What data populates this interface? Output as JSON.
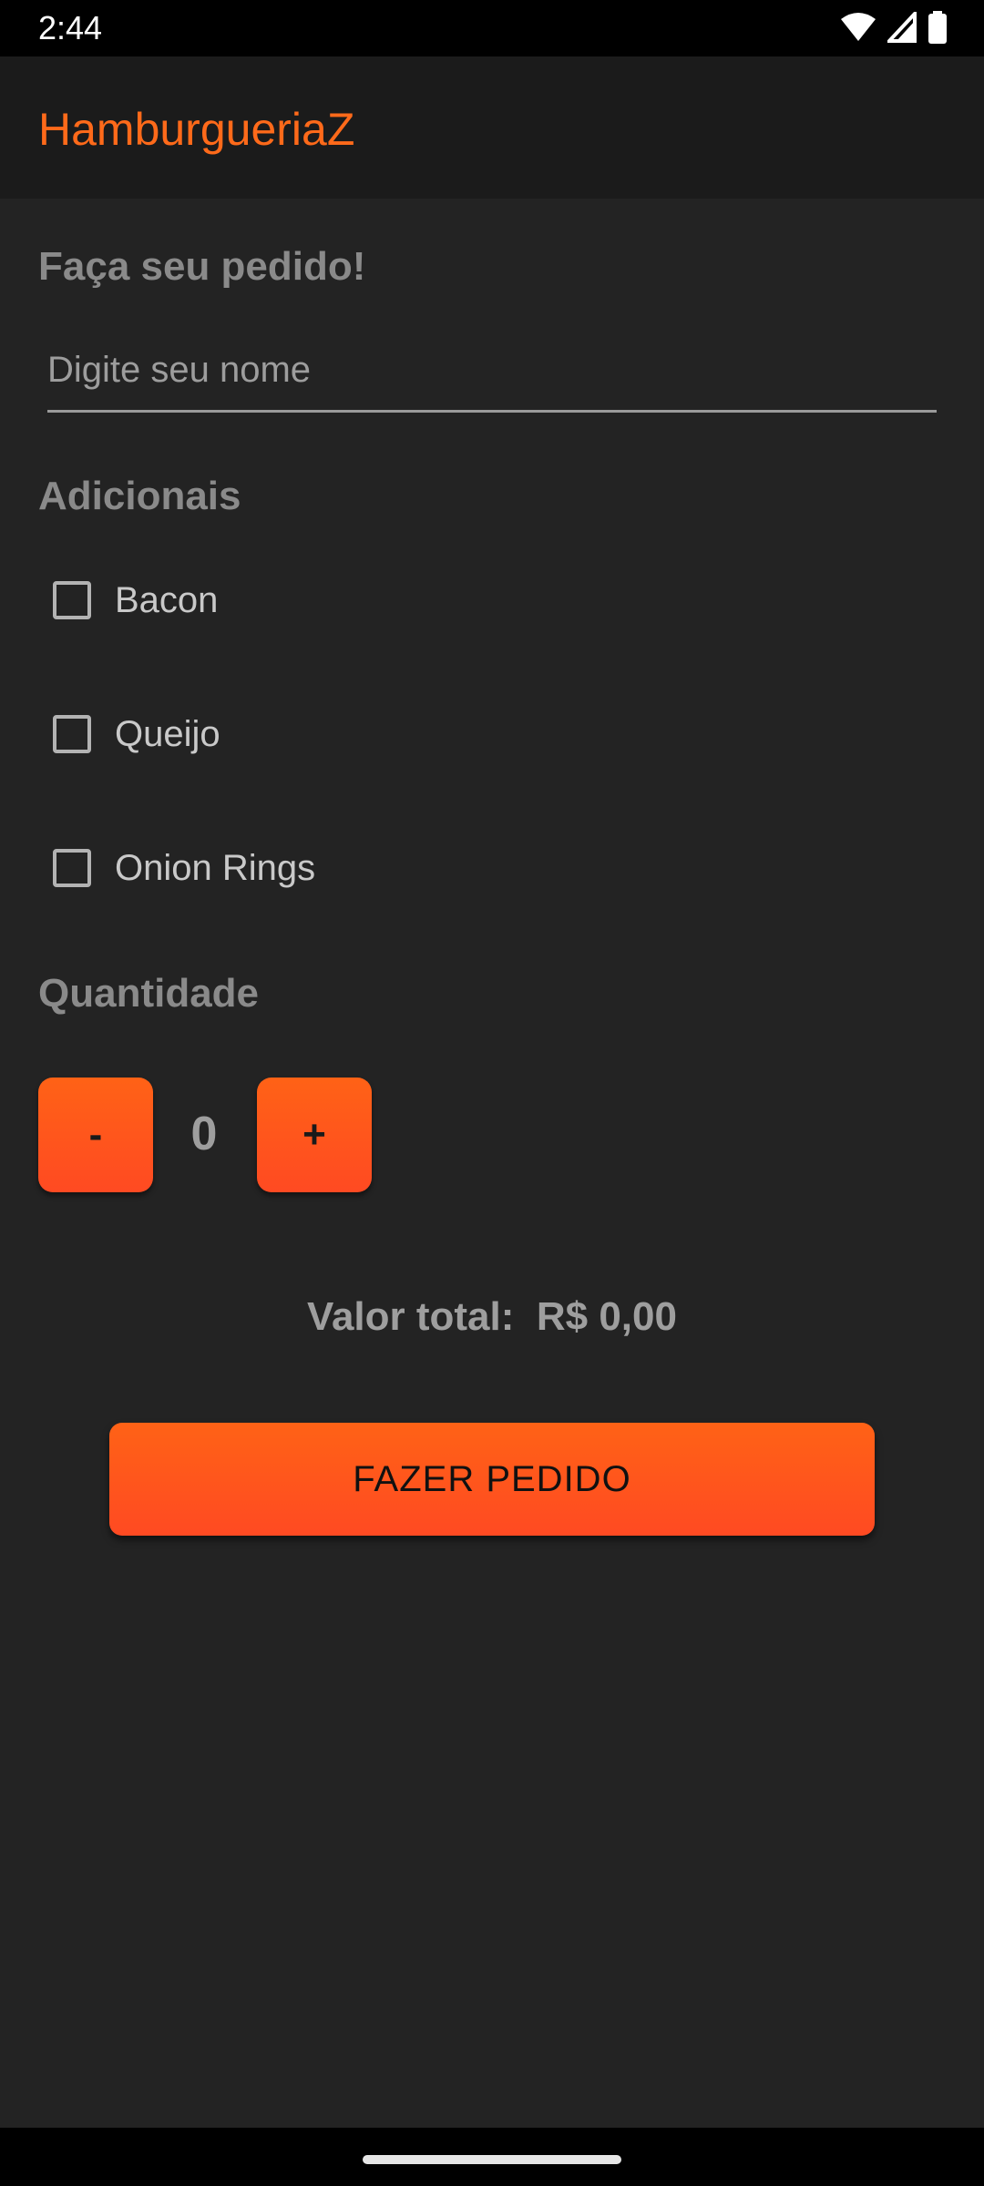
{
  "status_bar": {
    "time": "2:44",
    "icons": [
      "wifi-icon",
      "signal-icon",
      "battery-icon"
    ]
  },
  "app_bar": {
    "title": "HamburgueriaZ"
  },
  "order": {
    "heading": "Faça seu pedido!",
    "name_placeholder": "Digite seu nome",
    "name_value": ""
  },
  "extras": {
    "heading": "Adicionais",
    "items": [
      {
        "label": "Bacon",
        "checked": false
      },
      {
        "label": "Queijo",
        "checked": false
      },
      {
        "label": "Onion Rings",
        "checked": false
      }
    ]
  },
  "quantity": {
    "heading": "Quantidade",
    "minus_label": "-",
    "plus_label": "+",
    "value": "0"
  },
  "total": {
    "label": "Valor total:",
    "value": "R$ 0,00"
  },
  "submit": {
    "label": "FAZER PEDIDO"
  },
  "colors": {
    "accent": "#ff5a1c",
    "background": "#232323",
    "app_bar": "#1b1b1b",
    "title": "#ff6a1a"
  }
}
